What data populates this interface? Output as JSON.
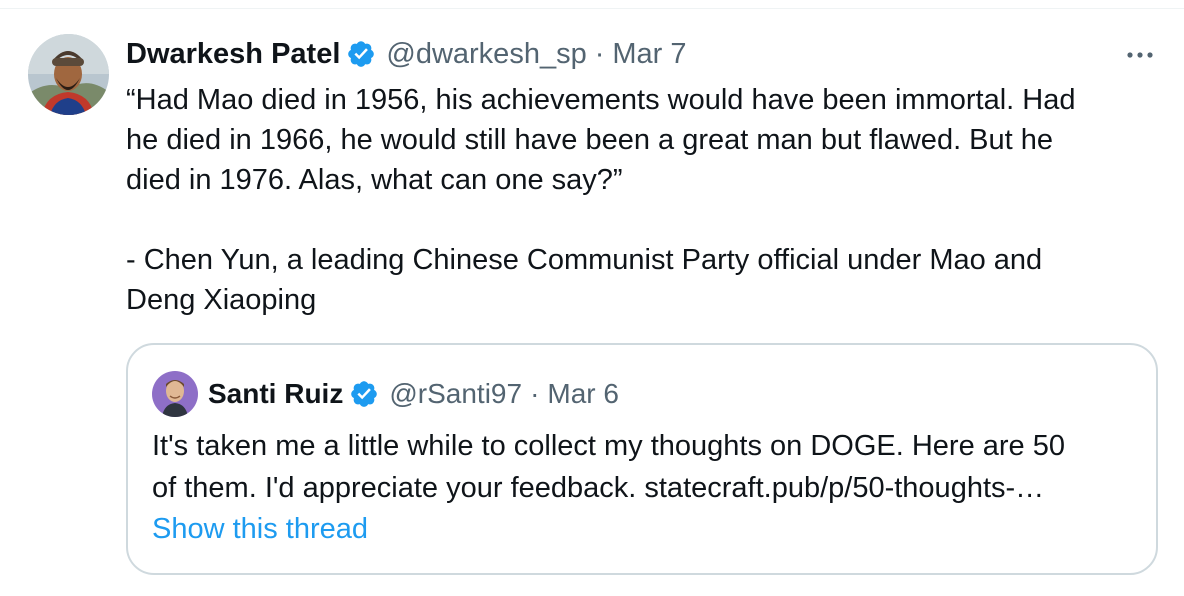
{
  "tweet": {
    "author": {
      "name": "Dwarkesh Patel",
      "handle": "@dwarkesh_sp",
      "verified": true
    },
    "separator": "·",
    "date": "Mar 7",
    "more_icon": "more-horizontal-icon",
    "text_lines": [
      "“Had Mao died in 1956, his achievements would have been immortal. Had",
      "he died in 1966, he would still have been a great man but flawed. But he",
      "died in 1976. Alas, what can one say?”",
      "",
      "- Chen Yun, a leading Chinese Communist Party official under Mao and",
      "Deng Xiaoping"
    ]
  },
  "quote_tweet": {
    "author": {
      "name": "Santi Ruiz",
      "handle": "@rSanti97",
      "verified": true
    },
    "separator": "·",
    "date": "Mar 6",
    "text_lines": [
      "It's taken me a little while to collect my thoughts on DOGE. Here are 50",
      "of them. I'd appreciate your feedback. statecraft.pub/p/50-thoughts-…"
    ],
    "show_thread": "Show this thread"
  },
  "colors": {
    "text_primary": "#0f1419",
    "text_secondary": "#536471",
    "link": "#1d9bf0",
    "verified": "#1d9bf0",
    "border": "#cfd9de"
  }
}
